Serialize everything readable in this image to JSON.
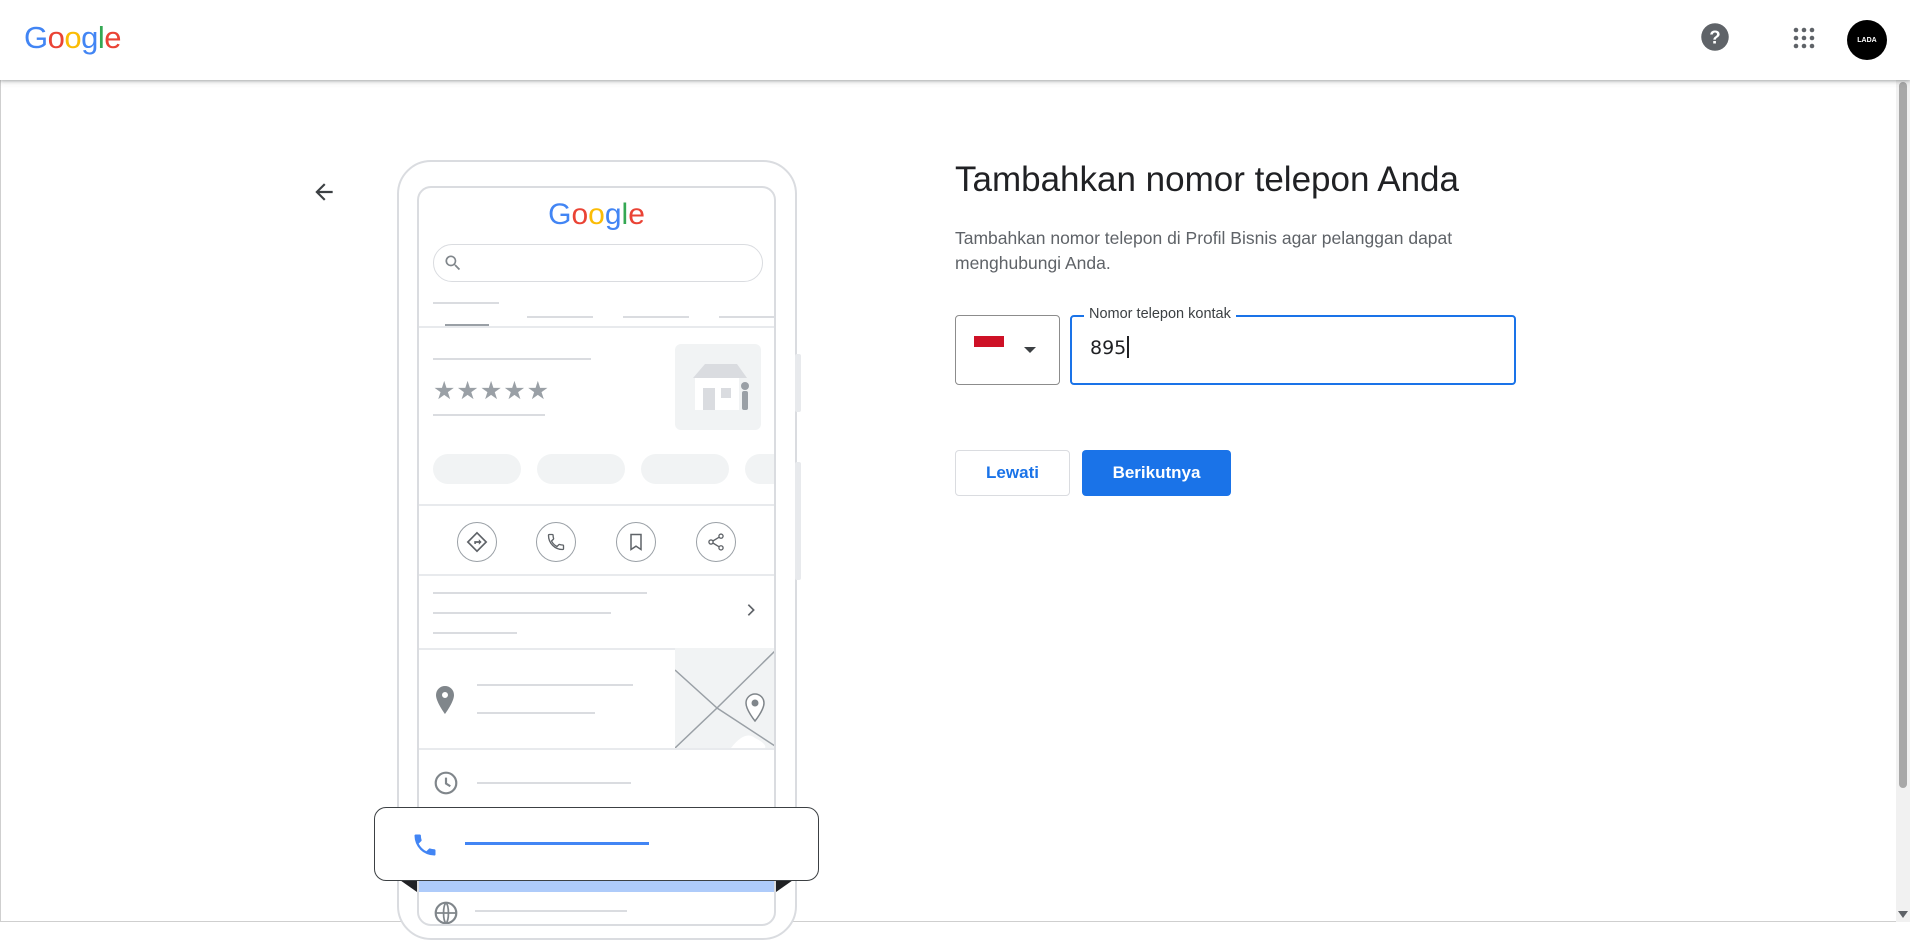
{
  "header": {
    "logo_letters": [
      "G",
      "o",
      "o",
      "g",
      "l",
      "e"
    ],
    "logo_colors": [
      "#4285F4",
      "#EA4335",
      "#FBBC05",
      "#4285F4",
      "#34A853",
      "#EA4335"
    ],
    "avatar_text": "LADA"
  },
  "illustration": {
    "logo_letters": [
      "G",
      "o",
      "o",
      "g",
      "l",
      "e"
    ],
    "stars": "★★★★★"
  },
  "form": {
    "title": "Tambahkan nomor telepon Anda",
    "subtitle": "Tambahkan nomor telepon di Profil Bisnis agar pelanggan dapat menghubungi Anda.",
    "country_flag": "Indonesia flag",
    "phone_label": "Nomor telepon kontak",
    "phone_value": "895",
    "skip_label": "Lewati",
    "next_label": "Berikutnya"
  },
  "colors": {
    "accent": "#1a73e8",
    "flag_red": "#ce1126"
  },
  "icons": [
    "help-icon",
    "apps-grid-icon",
    "back-arrow-icon",
    "search-icon",
    "directions-icon",
    "call-icon",
    "bookmark-icon",
    "share-icon",
    "chevron-right-icon",
    "location-pin-icon",
    "clock-icon",
    "globe-icon"
  ]
}
